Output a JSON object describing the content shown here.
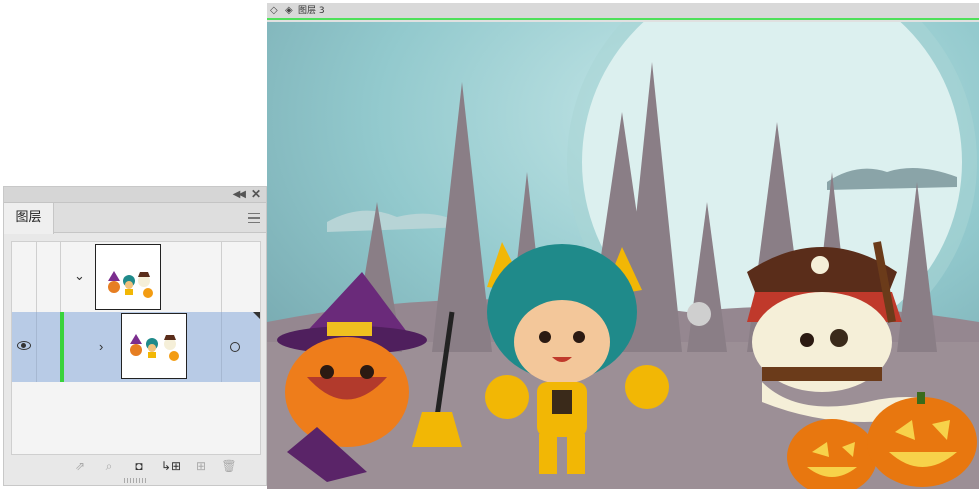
{
  "layers_panel": {
    "collapse_icon": "double-chevron-left-icon",
    "close_icon": "close-icon",
    "tab_label": "图层",
    "menu_icon": "hamburger-menu-icon",
    "rows": [
      {
        "expanded": true,
        "selected": false,
        "visible": false
      },
      {
        "expanded": false,
        "selected": true,
        "visible": true
      }
    ],
    "bottom_icons": [
      "export-icon",
      "search-icon",
      "clipping-mask-icon",
      "new-sublayer-icon",
      "new-layer-icon",
      "trash-icon"
    ]
  },
  "document": {
    "nav_icon": "diamond-arrows-icon",
    "layers_icon": "layers-stack-icon",
    "title": "图层 3",
    "tab_accent": "#4ee05a"
  },
  "colors": {
    "selected_row": "#b8cbe6",
    "active_indicator": "#39d33b",
    "sky": "#8fc9cf",
    "moon": "#dcf0ef"
  }
}
